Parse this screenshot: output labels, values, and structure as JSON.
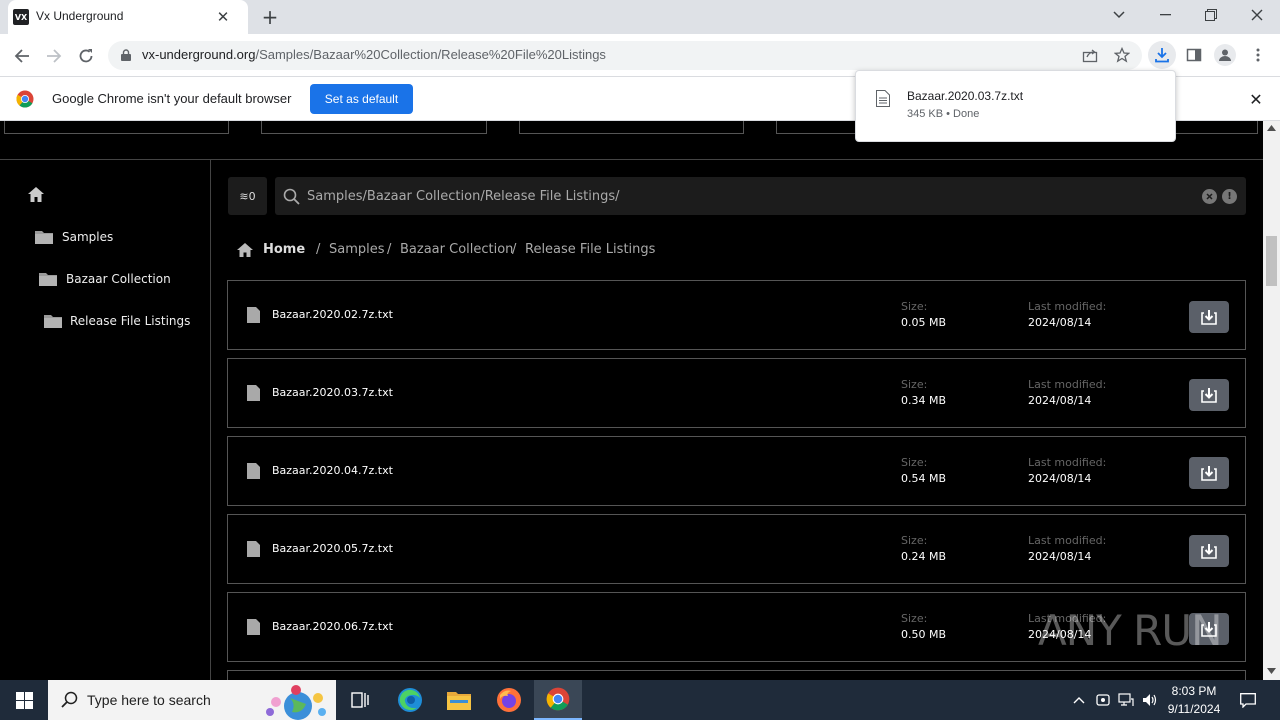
{
  "browser": {
    "tab_title": "Vx Underground",
    "favicon_text": "VX",
    "url_host": "vx-underground.org",
    "url_path": "/Samples/Bazaar%20Collection/Release%20File%20Listings",
    "infobar_text": "Google Chrome isn't your default browser",
    "set_default_label": "Set as default",
    "accent": "#1a73e8"
  },
  "download": {
    "filename": "Bazaar.2020.03.7z.txt",
    "meta": "345 KB • Done"
  },
  "sidebar": {
    "items": [
      {
        "label": "Samples"
      },
      {
        "label": "Bazaar Collection"
      },
      {
        "label": "Release File Listings"
      }
    ]
  },
  "search": {
    "filter_label": "≋0",
    "path": "Samples/Bazaar Collection/Release File Listings/"
  },
  "breadcrumb": {
    "home": "Home",
    "separator": "/",
    "items": [
      "Samples",
      "Bazaar Collection",
      "Release File Listings"
    ]
  },
  "files": {
    "size_label": "Size:",
    "modified_label": "Last modified:",
    "rows": [
      {
        "name": "Bazaar.2020.02.7z.txt",
        "size": "0.05 MB",
        "modified": "2024/08/14"
      },
      {
        "name": "Bazaar.2020.03.7z.txt",
        "size": "0.34 MB",
        "modified": "2024/08/14"
      },
      {
        "name": "Bazaar.2020.04.7z.txt",
        "size": "0.54 MB",
        "modified": "2024/08/14"
      },
      {
        "name": "Bazaar.2020.05.7z.txt",
        "size": "0.24 MB",
        "modified": "2024/08/14"
      },
      {
        "name": "Bazaar.2020.06.7z.txt",
        "size": "0.50 MB",
        "modified": "2024/08/14"
      }
    ]
  },
  "watermark": "ANY RUN",
  "taskbar": {
    "search_placeholder": "Type here to search",
    "time": "8:03 PM",
    "date": "9/11/2024"
  }
}
